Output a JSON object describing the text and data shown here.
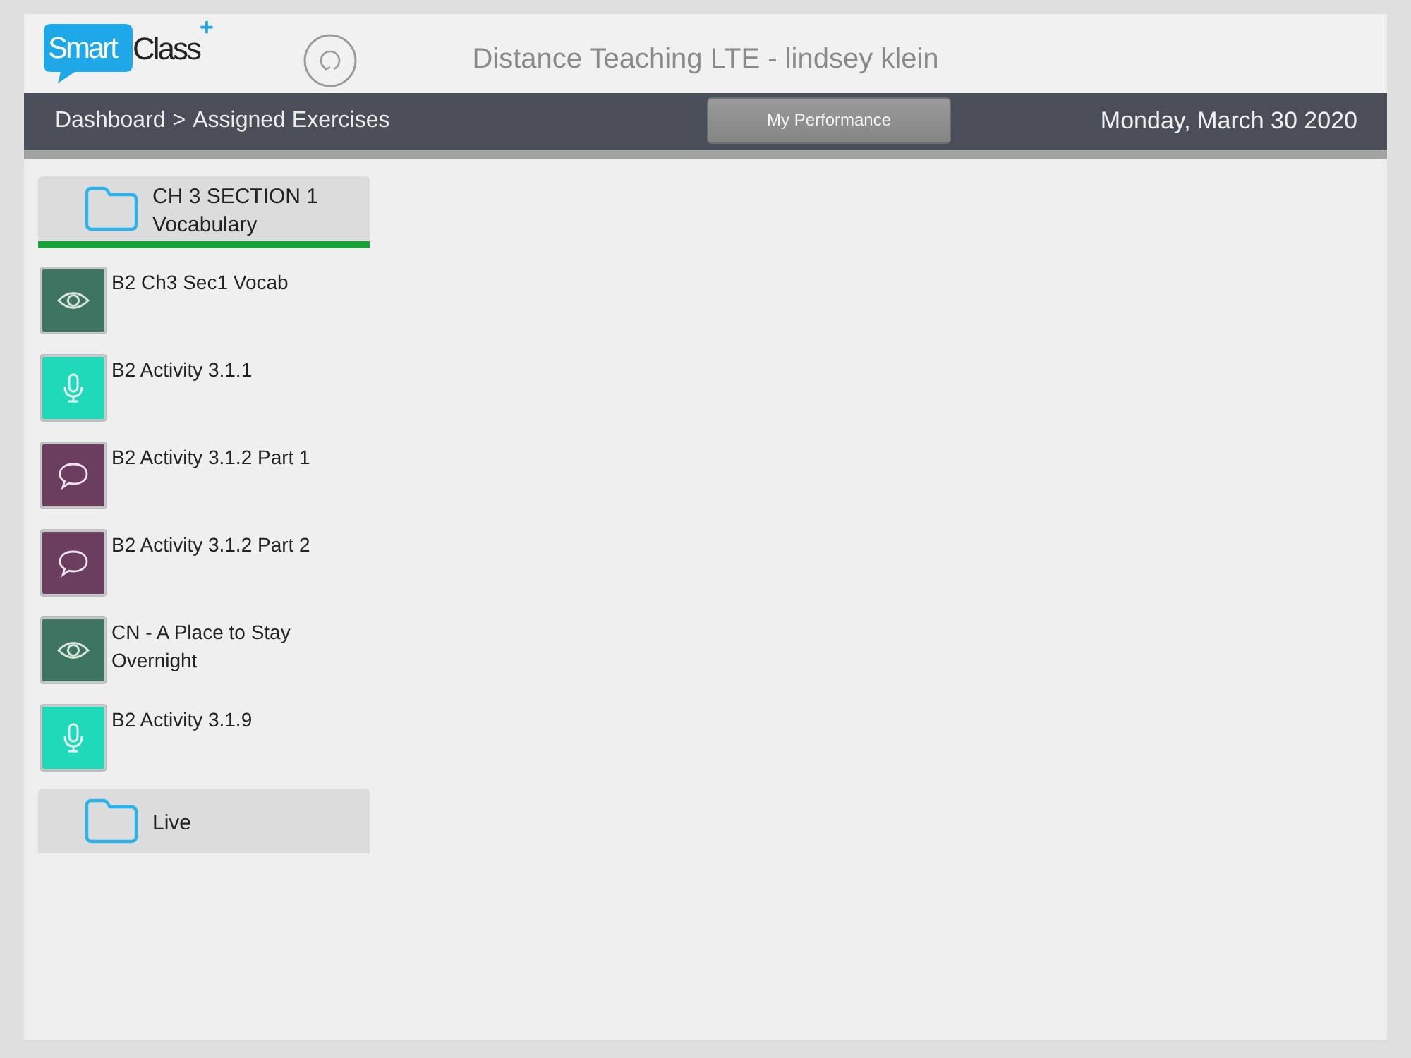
{
  "header": {
    "logo": {
      "bubble_text": "Smart",
      "text": "Class",
      "plus": "+"
    },
    "title": "Distance Teaching LTE - lindsey klein"
  },
  "nav": {
    "breadcrumb": {
      "items": [
        "Dashboard",
        "Assigned Exercises"
      ],
      "separator": ">"
    },
    "button": "My Performance",
    "date": "Monday, March 30 2020"
  },
  "folders": [
    {
      "title": "CH 3 SECTION 1 Vocabulary",
      "expanded": true,
      "exercises": [
        {
          "title": "B2 Ch3 Sec1 Vocab",
          "kind": "eye",
          "color": "#3e7462"
        },
        {
          "title": "B2 Activity 3.1.1",
          "kind": "mic",
          "color": "#1fd9b9"
        },
        {
          "title": "B2 Activity 3.1.2 Part 1",
          "kind": "chat",
          "color": "#6b3e5f"
        },
        {
          "title": "B2 Activity 3.1.2 Part 2",
          "kind": "chat",
          "color": "#6b3e5f"
        },
        {
          "title": "CN - A Place to Stay Overnight",
          "kind": "eye",
          "color": "#3e7462"
        },
        {
          "title": "B2 Activity 3.1.9",
          "kind": "mic",
          "color": "#1fd9b9"
        }
      ]
    },
    {
      "title": "Live",
      "expanded": false
    }
  ]
}
